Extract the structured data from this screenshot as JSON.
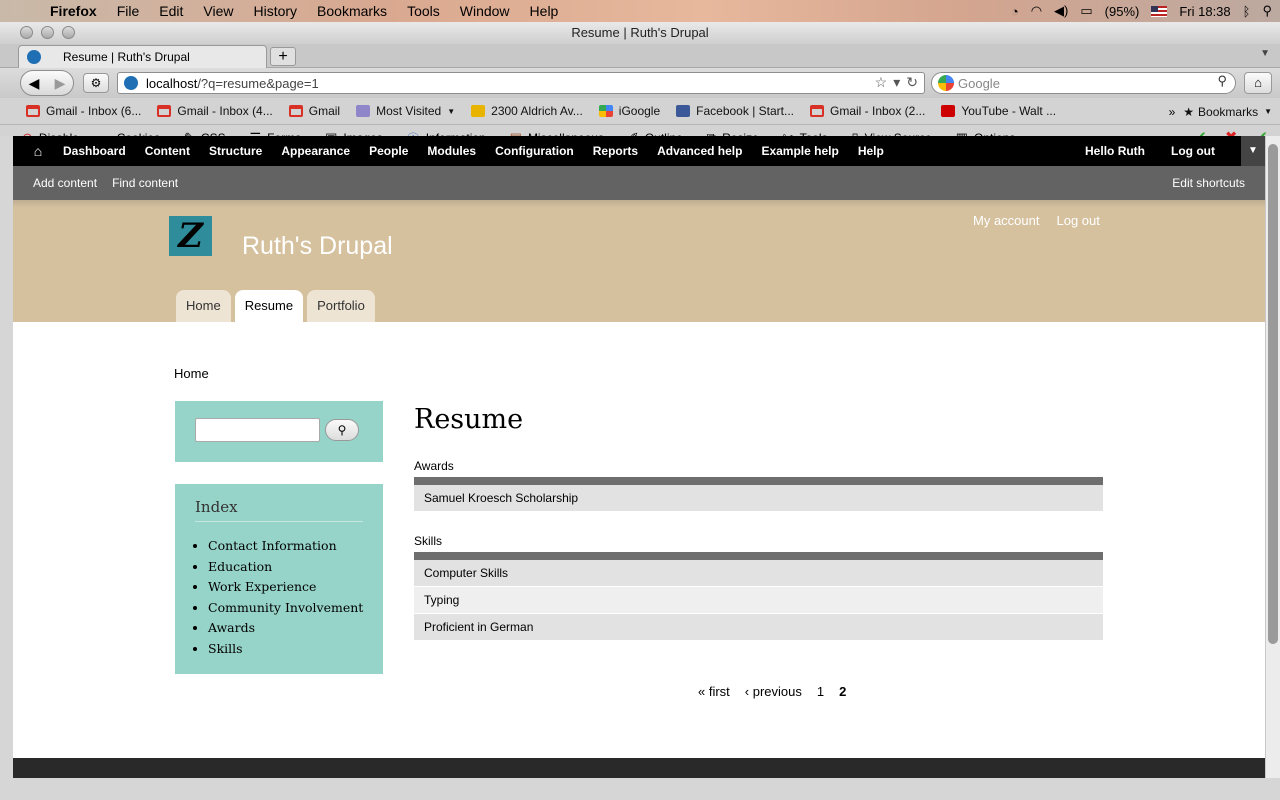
{
  "macos_menubar": {
    "app": "Firefox",
    "menus": [
      "File",
      "Edit",
      "View",
      "History",
      "Bookmarks",
      "Tools",
      "Window",
      "Help"
    ],
    "battery": "(95%)",
    "clock": "Fri 18:38"
  },
  "window": {
    "title": "Resume | Ruth's Drupal"
  },
  "tab": {
    "title": "Resume | Ruth's Drupal"
  },
  "urlbar": {
    "host": "localhost",
    "path": "/?q=resume&page=1"
  },
  "searchbar": {
    "placeholder": "Google"
  },
  "bookmarks": [
    {
      "label": "Gmail - Inbox (6...",
      "icon": "gmail-icon",
      "color": "#d93025"
    },
    {
      "label": "Gmail - Inbox (4...",
      "icon": "gmail-icon",
      "color": "#d93025"
    },
    {
      "label": "Gmail",
      "icon": "gmail-icon",
      "color": "#d93025"
    },
    {
      "label": "Most Visited",
      "icon": "folder-icon",
      "color": "#8f86c9"
    },
    {
      "label": "2300 Aldrich Av...",
      "icon": "maps-icon",
      "color": "#e8b400"
    },
    {
      "label": "iGoogle",
      "icon": "google-icon",
      "color": "#4285f4"
    },
    {
      "label": "Facebook | Start...",
      "icon": "facebook-icon",
      "color": "#3b5998"
    },
    {
      "label": "Gmail - Inbox (2...",
      "icon": "gmail-icon",
      "color": "#d93025"
    },
    {
      "label": "YouTube - Walt ...",
      "icon": "youtube-icon",
      "color": "#cc0000"
    }
  ],
  "bookmarks_menu": "Bookmarks",
  "devtoolbar": [
    "Disable",
    "Cookies",
    "CSS",
    "Forms",
    "Images",
    "Information",
    "Miscellaneous",
    "Outline",
    "Resize",
    "Tools",
    "View Source",
    "Options"
  ],
  "admin_toolbar": {
    "items": [
      "Dashboard",
      "Content",
      "Structure",
      "Appearance",
      "People",
      "Modules",
      "Configuration",
      "Reports",
      "Advanced help",
      "Example help",
      "Help"
    ],
    "user": "Hello Ruth",
    "logout": "Log out"
  },
  "shortcuts": {
    "items": [
      "Add content",
      "Find content"
    ],
    "edit": "Edit shortcuts"
  },
  "site": {
    "name": "Ruth's Drupal",
    "secondary_menu": [
      "My account",
      "Log out"
    ],
    "tabs": [
      "Home",
      "Resume",
      "Portfolio"
    ],
    "active_tab": "Resume",
    "header_color": "#d6c19f",
    "sidebar_color": "#96d3c8"
  },
  "breadcrumb": "Home",
  "sidebar": {
    "index_title": "Index",
    "index_items": [
      "Contact Information",
      "Education",
      "Work Experience",
      "Community Involvement",
      "Awards",
      "Skills"
    ]
  },
  "page": {
    "title": "Resume",
    "sections": [
      {
        "label": "Awards",
        "rows": [
          "Samuel Kroesch Scholarship"
        ]
      },
      {
        "label": "Skills",
        "rows": [
          "Computer Skills",
          "Typing",
          "Proficient in German"
        ]
      }
    ]
  },
  "pager": {
    "first": "« first",
    "previous": "‹ previous",
    "pages": [
      "1",
      "2"
    ],
    "current": "2"
  }
}
